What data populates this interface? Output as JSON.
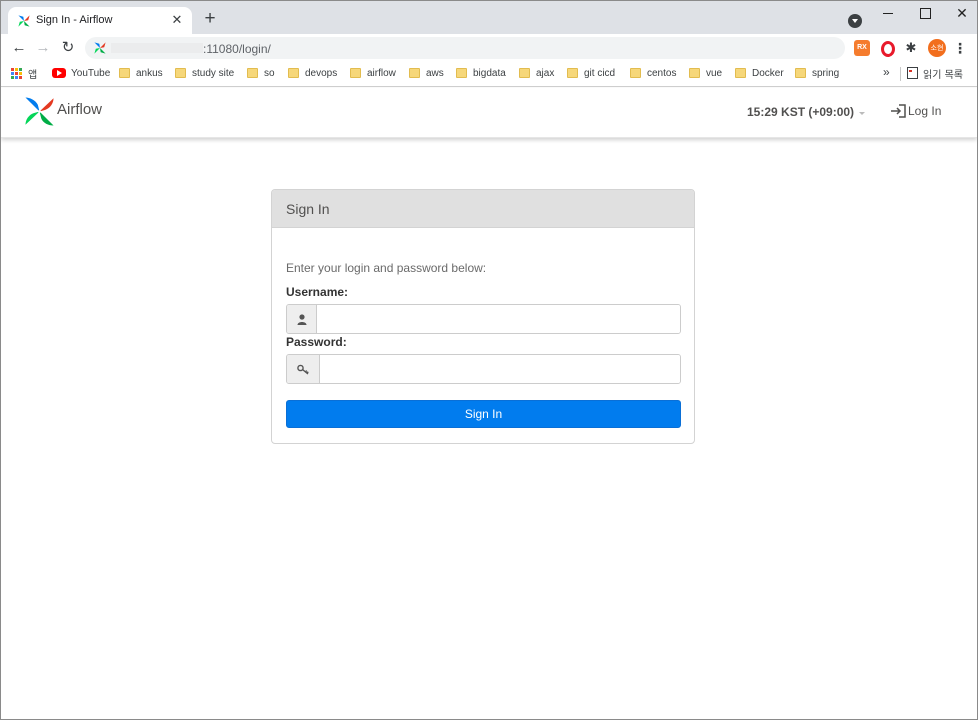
{
  "browser": {
    "tab": {
      "title": "Sign In - Airflow",
      "close": "✕"
    },
    "new_tab": "+",
    "window_controls": {
      "close": "✕"
    },
    "nav": {
      "back": "←",
      "forward": "→",
      "reload": "↻"
    },
    "address": {
      "url": ":11080/login/"
    },
    "extensions": [
      "RX",
      "opera-icon",
      "puzzle-icon"
    ],
    "profile_label": "소현",
    "menu": "⋮",
    "bookmarks": [
      {
        "label": "앱",
        "icon": "apps-grid-icon"
      },
      {
        "label": "YouTube",
        "icon": "youtube-icon"
      },
      {
        "label": "ankus",
        "icon": "folder-icon"
      },
      {
        "label": "study site",
        "icon": "folder-icon"
      },
      {
        "label": "so",
        "icon": "folder-icon"
      },
      {
        "label": "devops",
        "icon": "folder-icon"
      },
      {
        "label": "airflow",
        "icon": "folder-icon"
      },
      {
        "label": "aws",
        "icon": "folder-icon"
      },
      {
        "label": "bigdata",
        "icon": "folder-icon"
      },
      {
        "label": "ajax",
        "icon": "folder-icon"
      },
      {
        "label": "git cicd",
        "icon": "folder-icon"
      },
      {
        "label": "centos",
        "icon": "folder-icon"
      },
      {
        "label": "vue",
        "icon": "folder-icon"
      },
      {
        "label": "Docker",
        "icon": "folder-icon"
      },
      {
        "label": "spring",
        "icon": "folder-icon"
      }
    ],
    "bookmarks_overflow": "»",
    "reading_list": "읽기 목록"
  },
  "airflow": {
    "brand": "Airflow",
    "clock": "15:29 KST (+09:00)",
    "login_link": "Log In",
    "login_panel": {
      "heading": "Sign In",
      "hint": "Enter your login and password below:",
      "username_label": "Username:",
      "username_value": "",
      "username_icon": "user-icon",
      "password_label": "Password:",
      "password_value": "",
      "password_icon": "key-icon",
      "submit_label": "Sign In"
    }
  },
  "colors": {
    "primary_button": "#017cee",
    "tabstrip": "#dee1e6",
    "panel_heading": "#e0e0e0",
    "brand_text": "#51504f"
  }
}
